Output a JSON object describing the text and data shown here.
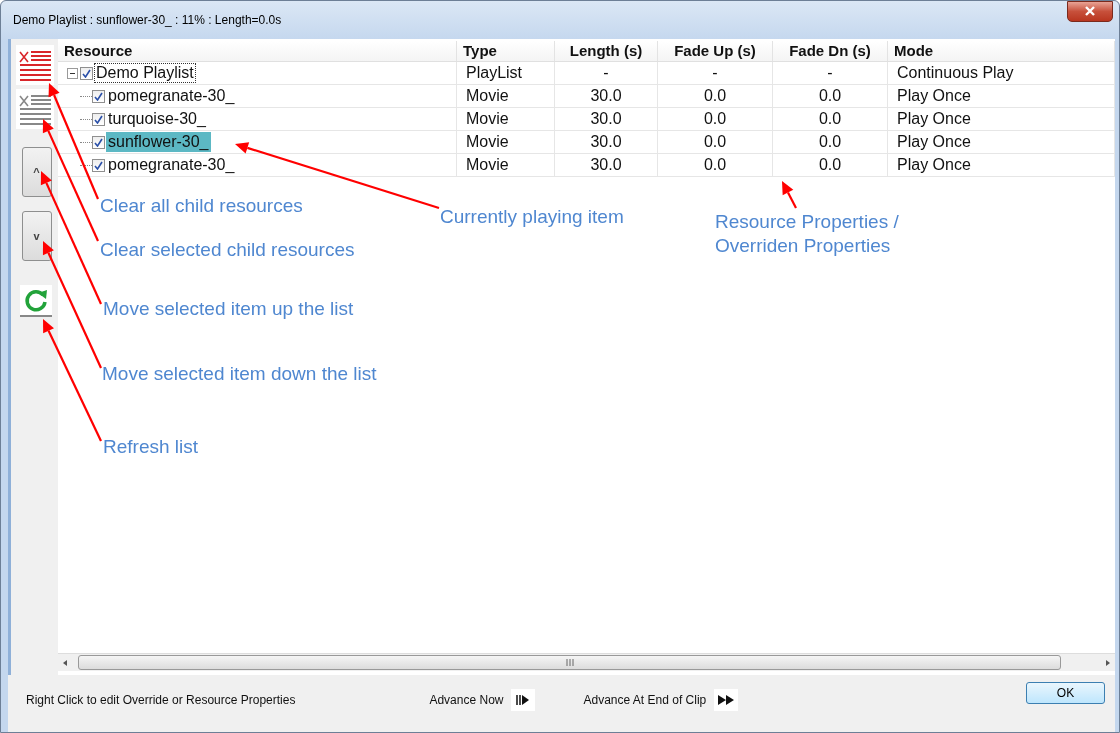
{
  "window": {
    "title": "Demo Playlist : sunflower-30_ : 11% : Length=0.0s"
  },
  "toolbar": {
    "buttons": [
      {
        "kind": "clear-all"
      },
      {
        "kind": "clear-selected"
      },
      {
        "kind": "up",
        "label": "^"
      },
      {
        "kind": "down",
        "label": "v"
      },
      {
        "kind": "refresh"
      }
    ]
  },
  "table": {
    "columns": [
      "Resource",
      "Type",
      "Length (s)",
      "Fade Up (s)",
      "Fade Dn (s)",
      "Mode"
    ],
    "tree": [
      {
        "label": "Demo Playlist",
        "checked": true,
        "selected": false,
        "focused": true,
        "expanded": true,
        "cells": [
          "PlayList",
          "-",
          "-",
          "-",
          "Continuous Play"
        ],
        "children": [
          {
            "label": "pomegranate-30_",
            "checked": true,
            "selected": false,
            "focused": false,
            "cells": [
              "Movie",
              "30.0",
              "0.0",
              "0.0",
              "Play Once"
            ]
          },
          {
            "label": "turquoise-30_",
            "checked": true,
            "selected": false,
            "focused": false,
            "cells": [
              "Movie",
              "30.0",
              "0.0",
              "0.0",
              "Play Once"
            ]
          },
          {
            "label": "sunflower-30_",
            "checked": true,
            "selected": true,
            "focused": false,
            "cells": [
              "Movie",
              "30.0",
              "0.0",
              "0.0",
              "Play Once"
            ]
          },
          {
            "label": "pomegranate-30_",
            "checked": true,
            "selected": false,
            "focused": false,
            "cells": [
              "Movie",
              "30.0",
              "0.0",
              "0.0",
              "Play Once"
            ]
          }
        ]
      }
    ]
  },
  "annotations": [
    "Clear all child resources",
    "Clear selected child resources",
    "Move selected item up the list",
    "Move selected item down the list",
    "Refresh list",
    "Currently playing item",
    "Resource Properties / Overriden Properties"
  ],
  "footer": {
    "hint": "Right Click to edit Override or Resource Properties",
    "advance_now": "Advance Now",
    "advance_end": "Advance At End of Clip",
    "ok": "OK"
  }
}
